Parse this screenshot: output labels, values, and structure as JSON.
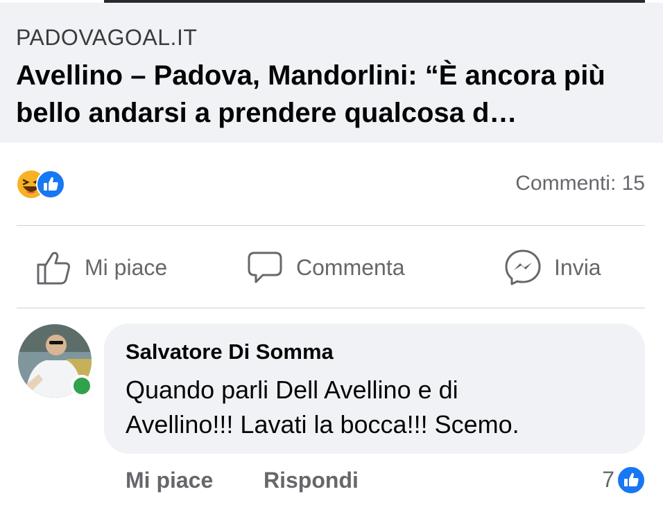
{
  "post": {
    "link_domain": "PADOVAGOAL.IT",
    "link_title": "Avellino – Padova, Mandorlini: “È ancora più bello andarsi a prendere qualcosa d…",
    "reaction_icons": [
      "haha-icon",
      "like-icon"
    ],
    "comments_count_label": "Commenti: 15"
  },
  "actions": {
    "like_label": "Mi piace",
    "comment_label": "Commenta",
    "send_label": "Invia"
  },
  "comment": {
    "author": "Salvatore Di Somma",
    "text_line1": "Quando parli Dell Avellino e di",
    "text_line2": "Avellino!!! Lavati la bocca!!! Scemo.",
    "like_label": "Mi piace",
    "reply_label": "Rispondi",
    "like_count": "7"
  },
  "colors": {
    "facebook_blue": "#1877f2",
    "secondary_text": "#65676b",
    "online_green": "#31a24c",
    "card_background": "#f0f2f5"
  }
}
